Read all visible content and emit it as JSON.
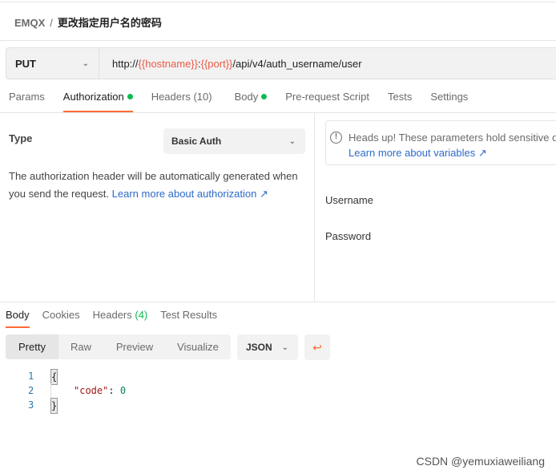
{
  "breadcrumb": {
    "collection": "EMQX",
    "separator": "/",
    "request": "更改指定用户名的密码"
  },
  "request": {
    "method": "PUT",
    "url_prefix": "http://",
    "var_host": "{{hostname}}",
    "colon": ":",
    "var_port": "{{port}}",
    "url_path": "/api/v4/auth_username/user"
  },
  "tabs": [
    {
      "label": "Params"
    },
    {
      "label": "Authorization"
    },
    {
      "label": "Headers",
      "count": "(10)"
    },
    {
      "label": "Body"
    },
    {
      "label": "Pre-request Script"
    },
    {
      "label": "Tests"
    },
    {
      "label": "Settings"
    }
  ],
  "auth": {
    "type_label": "Type",
    "type_value": "Basic Auth",
    "description": "The authorization header will be automatically generated when you send the request. ",
    "learn_link": "Learn more about authorization ↗",
    "alert_text": "Heads up! These parameters hold sensitive da",
    "alert_link": "Learn more about variables ↗",
    "username_label": "Username",
    "password_label": "Password"
  },
  "response": {
    "tabs": [
      {
        "label": "Body"
      },
      {
        "label": "Cookies"
      },
      {
        "label": "Headers",
        "count": "(4)"
      },
      {
        "label": "Test Results"
      }
    ],
    "views": [
      "Pretty",
      "Raw",
      "Preview",
      "Visualize"
    ],
    "format": "JSON",
    "lines": [
      "1",
      "2",
      "3"
    ],
    "open": "{",
    "key": "\"code\"",
    "colon": ": ",
    "value": "0",
    "close": "}"
  },
  "watermark": "CSDN @yemuxiaweiliang",
  "colors": {
    "accent": "#ff6c37",
    "dot": "#0cbb52",
    "variable": "#eb5a46",
    "link": "#2e6ac9"
  }
}
